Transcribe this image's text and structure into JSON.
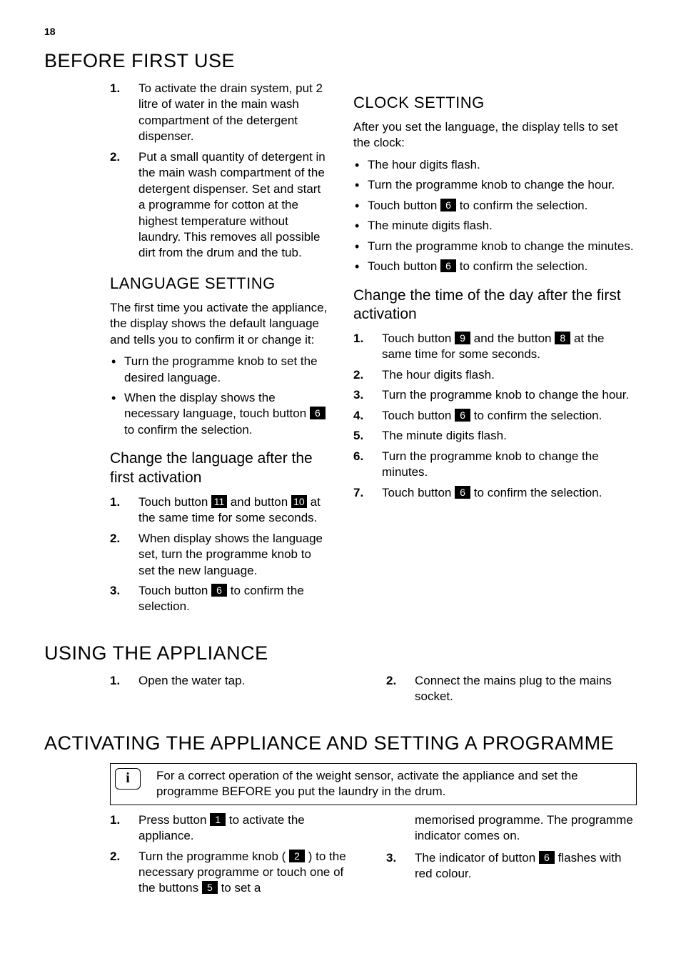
{
  "page_number": "18",
  "h1_before_first_use": "BEFORE FIRST USE",
  "before_first_use_list": [
    "To activate the drain system, put 2 litre of water in the main wash compartment of the detergent dispenser.",
    "Put a small quantity of detergent in the main wash compartment of the detergent dispenser. Set and start a programme for cotton at the highest temperature without laundry. This removes all possible dirt from the drum and the tub."
  ],
  "h2_language_setting": "LANGUAGE SETTING",
  "language_intro": "The first time you activate the appliance, the display shows the default language and tells you to confirm it or change it:",
  "language_bullets": {
    "b1": "Turn the programme knob to set the desired language.",
    "b2_pre": "When the display shows the necessary language, touch button ",
    "b2_num": "6",
    "b2_post": " to confirm the selection."
  },
  "h3_change_language": "Change the language after the first activation",
  "change_language_list": {
    "i1_pre": "Touch button ",
    "i1_n1": "11",
    "i1_mid": " and button ",
    "i1_n2": "10",
    "i1_post": " at the same time for some seconds.",
    "i2": "When display shows the language set, turn the programme knob to set the new language.",
    "i3_pre": "Touch button ",
    "i3_n": "6",
    "i3_post": " to confirm the selection."
  },
  "h2_clock_setting": "CLOCK SETTING",
  "clock_intro": "After you set the language, the display tells to set the clock:",
  "clock_bullets": {
    "b1": "The hour digits flash.",
    "b2": "Turn the programme knob to change the hour.",
    "b3_pre": "Touch button ",
    "b3_n": "6",
    "b3_post": " to confirm the selection.",
    "b4": "The minute digits flash.",
    "b5": "Turn the programme knob to change the minutes.",
    "b6_pre": "Touch button ",
    "b6_n": "6",
    "b6_post": " to confirm the selection."
  },
  "h3_change_time": "Change the time of the day after the first activation",
  "change_time_list": {
    "i1_pre": "Touch button ",
    "i1_n1": "9",
    "i1_mid": " and the button ",
    "i1_n2": "8",
    "i1_post": " at the same time for some seconds.",
    "i2": "The hour digits flash.",
    "i3": "Turn the programme knob to change the hour.",
    "i4_pre": "Touch button ",
    "i4_n": "6",
    "i4_post": " to confirm the selection.",
    "i5": "The minute digits flash.",
    "i6": "Turn the programme knob to change the minutes.",
    "i7_pre": "Touch button ",
    "i7_n": "6",
    "i7_post": " to confirm the selection."
  },
  "h1_using_appliance": "USING THE APPLIANCE",
  "using_list": {
    "i1": "Open the water tap.",
    "i2": "Connect the mains plug to the mains socket."
  },
  "h1_activating": "ACTIVATING THE APPLIANCE AND SETTING A PROGRAMME",
  "info_box": "For a correct operation of the weight sensor, activate the appliance and set the programme BEFORE you put the laundry in the drum.",
  "info_letter": "i",
  "activating_list": {
    "i1_pre": "Press button ",
    "i1_n": "1",
    "i1_post": " to activate the appliance.",
    "i2_pre": "Turn the programme knob ( ",
    "i2_n1": "2",
    "i2_mid": " ) to the necessary programme or touch one of the buttons ",
    "i2_n2": "5",
    "i2_post": " to set a memorised programme. The programme indicator comes on.",
    "i3_pre": "The indicator of button ",
    "i3_n": "6",
    "i3_post": " flashes with red colour."
  }
}
